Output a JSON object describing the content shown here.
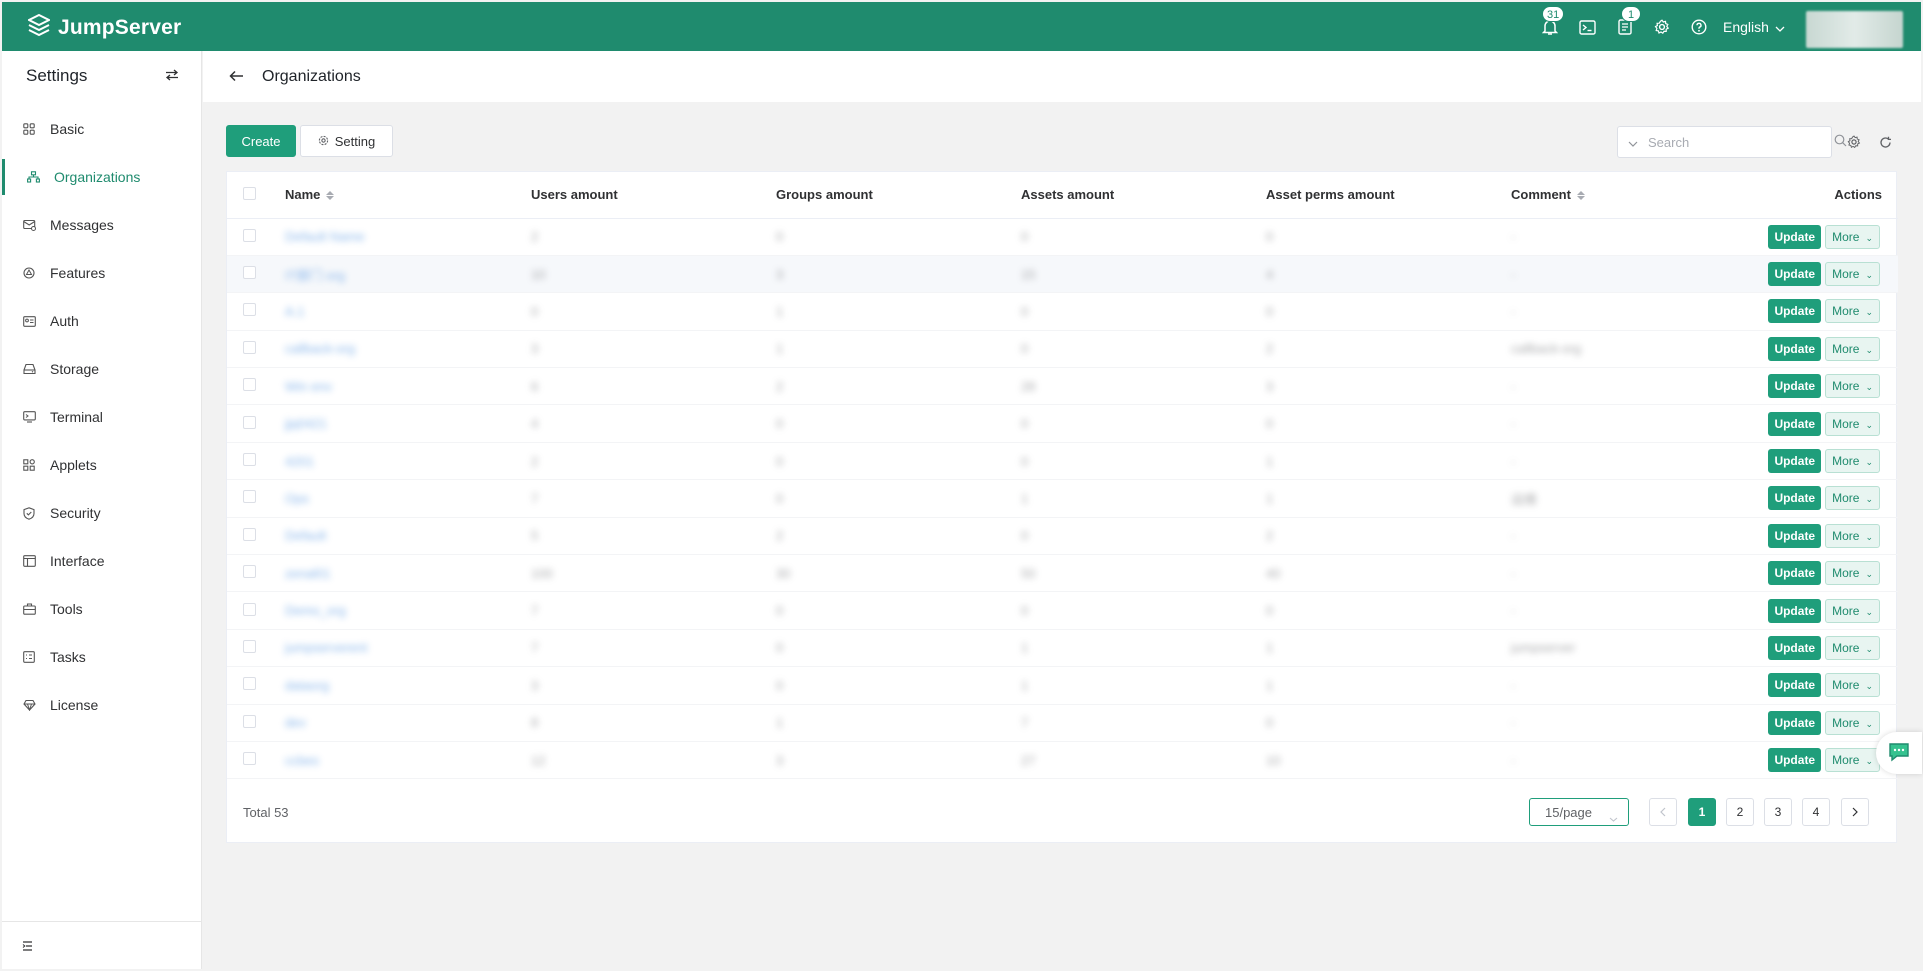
{
  "app": {
    "name": "JumpServer"
  },
  "topbar": {
    "notifications_count": "31",
    "tickets_count": "1",
    "language": "English"
  },
  "sidebar": {
    "title": "Settings",
    "items": [
      {
        "label": "Basic",
        "icon": "grid-icon"
      },
      {
        "label": "Organizations",
        "icon": "org-icon"
      },
      {
        "label": "Messages",
        "icon": "message-icon"
      },
      {
        "label": "Features",
        "icon": "features-icon"
      },
      {
        "label": "Auth",
        "icon": "id-card-icon"
      },
      {
        "label": "Storage",
        "icon": "storage-icon"
      },
      {
        "label": "Terminal",
        "icon": "terminal-icon"
      },
      {
        "label": "Applets",
        "icon": "applets-icon"
      },
      {
        "label": "Security",
        "icon": "shield-icon"
      },
      {
        "label": "Interface",
        "icon": "interface-icon"
      },
      {
        "label": "Tools",
        "icon": "toolbox-icon"
      },
      {
        "label": "Tasks",
        "icon": "tasks-icon"
      },
      {
        "label": "License",
        "icon": "license-icon"
      }
    ],
    "active": "Organizations"
  },
  "page": {
    "title": "Organizations"
  },
  "toolbar": {
    "create_label": "Create",
    "setting_label": "Setting",
    "search_placeholder": "Search"
  },
  "table": {
    "columns": [
      "Name",
      "Users amount",
      "Groups amount",
      "Assets amount",
      "Asset perms amount",
      "Comment",
      "Actions"
    ],
    "row_actions": {
      "update": "Update",
      "more": "More"
    },
    "rows": [
      {
        "name": "Default Name",
        "users": "2",
        "groups": "0",
        "assets": "0",
        "perms": "0",
        "comment": "-"
      },
      {
        "name": "IT部门 org",
        "users": "10",
        "groups": "3",
        "assets": "15",
        "perms": "4",
        "comment": "-"
      },
      {
        "name": "A.1",
        "users": "0",
        "groups": "1",
        "assets": "0",
        "perms": "0",
        "comment": "-"
      },
      {
        "name": "callback-org",
        "users": "3",
        "groups": "1",
        "assets": "0",
        "perms": "2",
        "comment": "callback-org"
      },
      {
        "name": "Win env",
        "users": "6",
        "groups": "2",
        "assets": "28",
        "perms": "3",
        "comment": "-"
      },
      {
        "name": "jjq0421",
        "users": "4",
        "groups": "0",
        "assets": "0",
        "perms": "0",
        "comment": "-"
      },
      {
        "name": "4201",
        "users": "2",
        "groups": "0",
        "assets": "0",
        "perms": "1",
        "comment": "-"
      },
      {
        "name": "Ops",
        "users": "7",
        "groups": "0",
        "assets": "1",
        "perms": "1",
        "comment": "运维"
      },
      {
        "name": "Default",
        "users": "5",
        "groups": "2",
        "assets": "0",
        "perms": "2",
        "comment": "-"
      },
      {
        "name": "zenal01",
        "users": "100",
        "groups": "30",
        "assets": "50",
        "perms": "40",
        "comment": "-"
      },
      {
        "name": "Demo_org",
        "users": "7",
        "groups": "0",
        "assets": "0",
        "perms": "0",
        "comment": "-"
      },
      {
        "name": "jumpserverent",
        "users": "7",
        "groups": "0",
        "assets": "1",
        "perms": "1",
        "comment": "jumpserver"
      },
      {
        "name": "dataorg",
        "users": "3",
        "groups": "0",
        "assets": "1",
        "perms": "1",
        "comment": "-"
      },
      {
        "name": "dev",
        "users": "8",
        "groups": "1",
        "assets": "7",
        "perms": "0",
        "comment": "-"
      },
      {
        "name": "ccbes",
        "users": "12",
        "groups": "3",
        "assets": "27",
        "perms": "10",
        "comment": "-"
      }
    ]
  },
  "pagination": {
    "total_label": "Total 53",
    "page_size": "15/page",
    "pages": [
      "1",
      "2",
      "3",
      "4"
    ],
    "current": "1"
  }
}
